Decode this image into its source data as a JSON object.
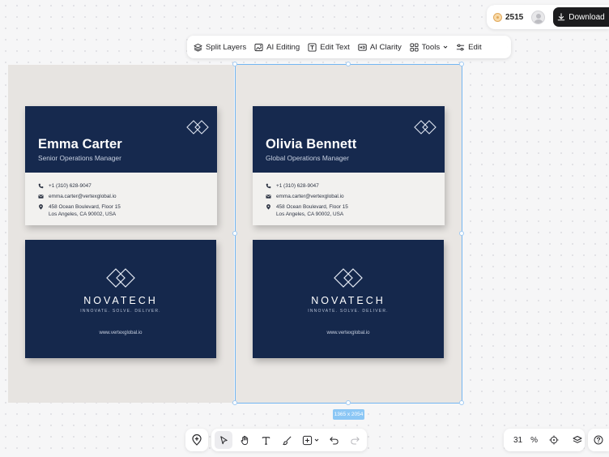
{
  "account": {
    "credits": "2515",
    "download_label": "Download"
  },
  "toolbar": {
    "split_layers": "Split Layers",
    "ai_editing": "AI Editing",
    "edit_text": "Edit Text",
    "ai_clarity": "AI Clarity",
    "tools": "Tools",
    "edit": "Edit"
  },
  "cards": [
    {
      "name": "Emma Carter",
      "title": "Senior Operations Manager",
      "phone": "+1 (310) 628-9047",
      "email": "emma.carter@vertexglobal.io",
      "address_line1": "458 Ocean Boulevard, Floor 15",
      "address_line2": "Los Angeles, CA 90002, USA",
      "brand": "NOVATECH",
      "tagline": "INNOVATE. SOLVE. DELIVER.",
      "website": "www.vertexglobal.io"
    },
    {
      "name": "Olivia Bennett",
      "title": "Global Operations Manager",
      "phone": "+1 (310) 628-9047",
      "email": "emma.carter@vertexglobal.io",
      "address_line1": "458 Ocean Boulevard, Floor 15",
      "address_line2": "Los Angeles, CA 90002, USA",
      "brand": "NOVATECH",
      "tagline": "INNOVATE. SOLVE. DELIVER.",
      "website": "www.vertexglobal.io"
    }
  ],
  "selection": {
    "size_label": "1365 x 2054"
  },
  "zoom": {
    "value": "31",
    "unit": "%"
  },
  "colors": {
    "card_navy": "#16294e",
    "selection_blue": "#73b6f2",
    "download_bg": "#1c1c1e"
  }
}
